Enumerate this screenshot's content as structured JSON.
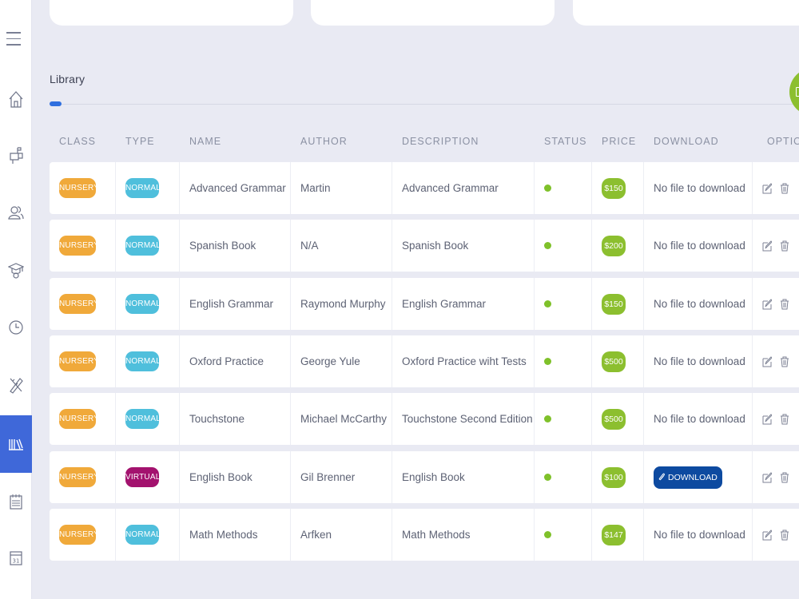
{
  "library": {
    "title": "Library"
  },
  "columns": {
    "class": "CLASS",
    "type": "TYPE",
    "name": "NAME",
    "author": "AUTHOR",
    "description": "DESCRIPTION",
    "status": "STATUS",
    "price": "PRICE",
    "download": "DOWNLOAD",
    "options": "OPTIONS"
  },
  "sidebar": {
    "items": [
      {
        "icon": "home-icon"
      },
      {
        "icon": "mailbox-icon"
      },
      {
        "icon": "users-icon"
      },
      {
        "icon": "graduation-icon"
      },
      {
        "icon": "clock-icon"
      },
      {
        "icon": "pencil-ruler-icon"
      },
      {
        "icon": "library-icon",
        "active": true
      },
      {
        "icon": "planner-icon"
      },
      {
        "icon": "calendar-icon",
        "label": "31"
      }
    ]
  },
  "rows": [
    {
      "class": "NURSERY",
      "type": "NORMAL",
      "name": "Advanced Grammar",
      "author": "Martin",
      "description": "Advanced Grammar",
      "price": "$150",
      "download": "No file to download"
    },
    {
      "class": "NURSERY",
      "type": "NORMAL",
      "name": "Spanish Book",
      "author": "N/A",
      "description": "Spanish Book",
      "price": "$200",
      "download": "No file to download"
    },
    {
      "class": "NURSERY",
      "type": "NORMAL",
      "name": "English Grammar",
      "author": "Raymond Murphy",
      "description": "English Grammar",
      "price": "$150",
      "download": "No file to download"
    },
    {
      "class": "NURSERY",
      "type": "NORMAL",
      "name": "Oxford Practice",
      "author": "George Yule",
      "description": "Oxford Practice wiht Tests",
      "price": "$500",
      "download": "No file to download"
    },
    {
      "class": "NURSERY",
      "type": "NORMAL",
      "name": "Touchstone",
      "author": "Michael McCarthy",
      "description": "Touchstone Second Edition",
      "price": "$500",
      "download": "No file to download"
    },
    {
      "class": "NURSERY",
      "type": "VIRTUAL",
      "name": "English Book",
      "author": "Gil Brenner",
      "description": "English Book",
      "price": "$100",
      "download_button": "DOWNLOAD"
    },
    {
      "class": "NURSERY",
      "type": "NORMAL",
      "name": "Math Methods",
      "author": "Arfken",
      "description": "Math Methods",
      "price": "$147",
      "download": "No file to download"
    }
  ],
  "colors": {
    "accent": "#3f68d9",
    "class_pill": "#f0a93a",
    "type_normal": "#4fbfdc",
    "type_virtual": "#a3126e",
    "price": "#8cbf2f",
    "status_active": "#7fc12a",
    "download_button": "#0d4aa0"
  }
}
